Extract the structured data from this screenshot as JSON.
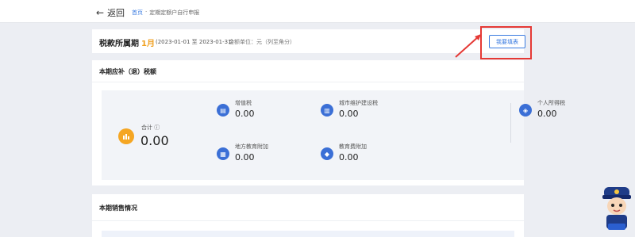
{
  "header": {
    "back_label": "返回",
    "breadcrumb": [
      {
        "label": "首页"
      },
      {
        "label": "·"
      },
      {
        "label": "定期定额户自行申报"
      }
    ]
  },
  "period": {
    "label": "税款所属期",
    "month": "1月",
    "range": "(2023-01-01 至 2023-01-31)",
    "unit": "金额单位：元（列至角分）",
    "fill_button": "我要填表"
  },
  "tax_section": {
    "title": "本期应补（退）税额",
    "total_label": "合计 ⓘ",
    "total_value": "0.00",
    "items": [
      {
        "name": "增值税",
        "value": "0.00",
        "icon": "invoice-icon"
      },
      {
        "name": "城市维护建设税",
        "value": "0.00",
        "icon": "building-icon"
      },
      {
        "name": "个人所得税",
        "value": "0.00",
        "icon": "shield-icon"
      },
      {
        "name": "地方教育附加",
        "value": "0.00",
        "icon": "document-icon"
      },
      {
        "name": "教育费附加",
        "value": "0.00",
        "icon": "graduation-cap-icon"
      }
    ]
  },
  "sales_section": {
    "title": "本期销售情况"
  },
  "colors": {
    "accent": "#3a7be0",
    "highlight": "#e53935",
    "total_icon": "#f5a623",
    "item_icon": "#3b6fd6"
  }
}
